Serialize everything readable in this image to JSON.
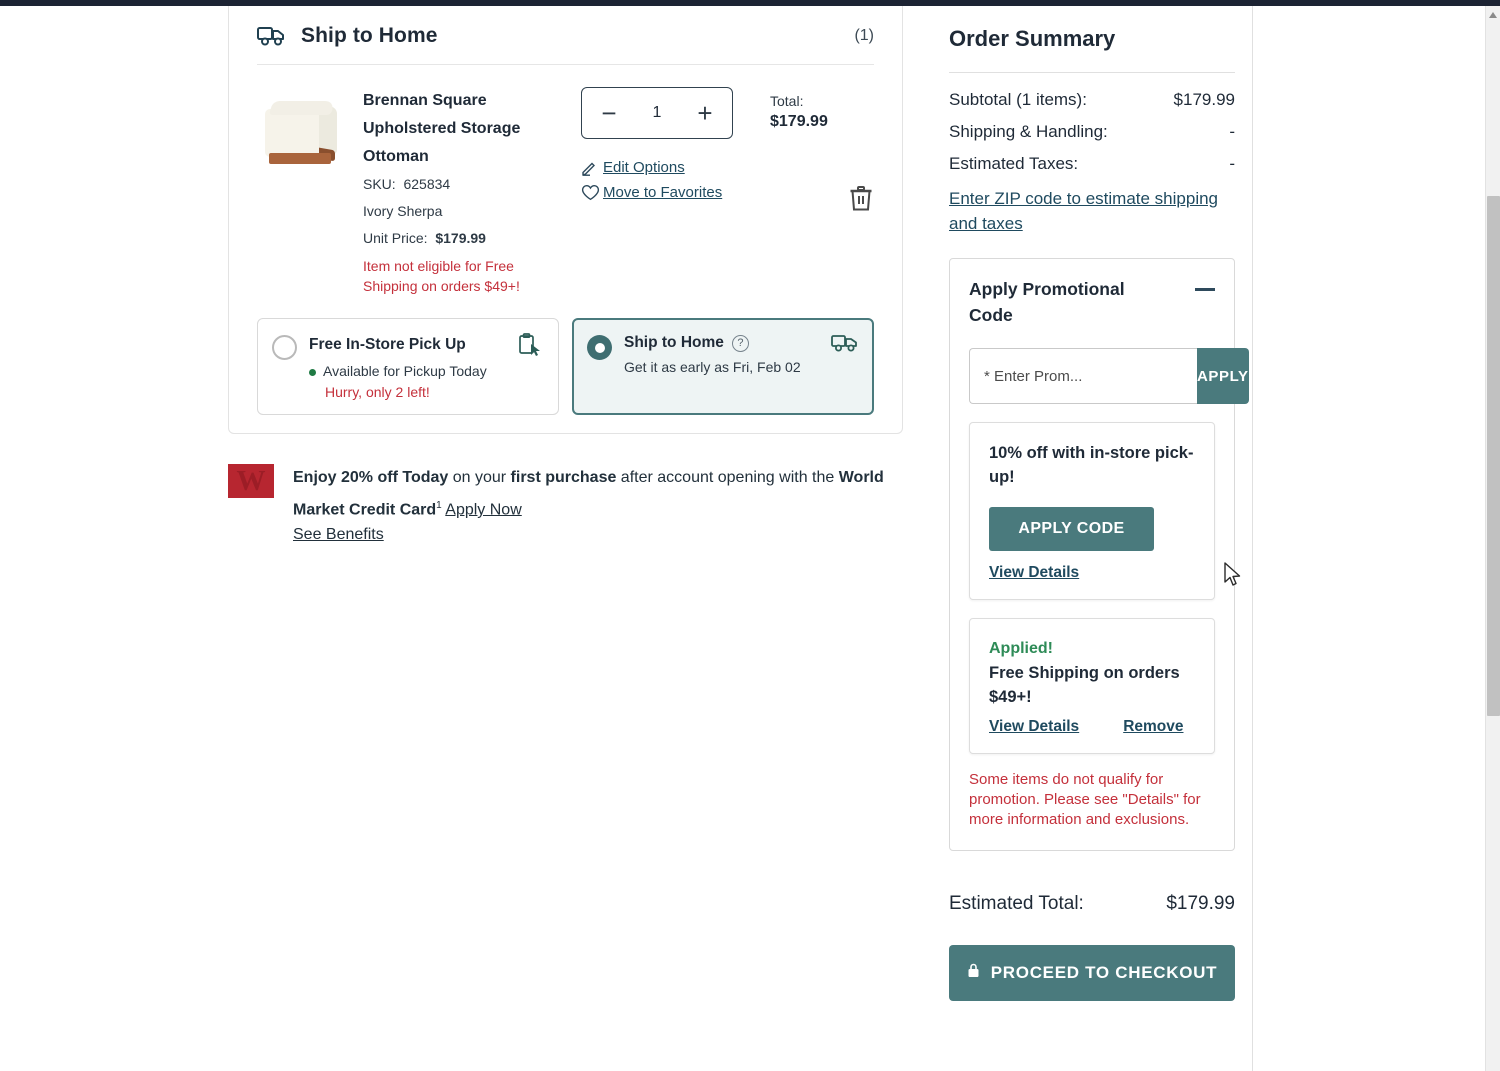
{
  "cart": {
    "section_title": "Ship to Home",
    "section_count": "(1)",
    "truck_icon": "truck-icon",
    "item": {
      "title": "Brennan Square Upholstered Storage Ottoman",
      "sku_label": "SKU:",
      "sku_value": "625834",
      "color": "Ivory Sherpa",
      "unit_price_label": "Unit Price:",
      "unit_price_value": "$179.99",
      "warning": "Item not eligible for Free Shipping on orders $49+!",
      "quantity": "1",
      "decrement": "−",
      "increment": "+",
      "edit_options": "Edit Options",
      "move_to_favorites": "Move to Favorites",
      "total_label": "Total:",
      "total_value": "$179.99",
      "remove_icon": "trash-icon",
      "edit_icon": "pencil-icon",
      "favorite_icon": "heart-icon"
    },
    "delivery_options": [
      {
        "title": "Free In-Store Pick Up",
        "icon": "store-pickup-icon",
        "availability": "Available for Pickup Today",
        "urgency": "Hurry, only 2 left!",
        "selected": false
      },
      {
        "title": "Ship to Home",
        "icon": "truck-icon",
        "help_icon": "question-mark-icon",
        "eta": "Get it as early as Fri, Feb 02",
        "selected": true
      }
    ]
  },
  "credit_banner": {
    "logo_letter": "W",
    "line1_a": "Enjoy 20% off Today",
    "line1_b": " on your ",
    "line1_c": "first purchase",
    "line1_d": " after account opening with the ",
    "line1_e": "World Market Credit Card",
    "footnote": "1",
    "apply_now": "Apply Now",
    "see_benefits": "See Benefits"
  },
  "summary": {
    "title": "Order Summary",
    "rows": [
      {
        "label": "Subtotal (1 items):",
        "value": "$179.99"
      },
      {
        "label": "Shipping & Handling:",
        "value": "-"
      },
      {
        "label": "Estimated Taxes:",
        "value": "-"
      }
    ],
    "zip_link": "Enter ZIP code to estimate shipping and taxes",
    "promo": {
      "title": "Apply Promotional Code",
      "collapse_icon": "minus-icon",
      "input_placeholder": "* Enter Prom...",
      "input_value": "",
      "apply_label": "APPLY",
      "offer": {
        "title": "10% off with in-store pick-up!",
        "apply_code_label": "APPLY CODE",
        "view_details": "View Details"
      },
      "applied": {
        "status": "Applied!",
        "title": "Free Shipping on orders $49+!",
        "view_details": "View Details",
        "remove": "Remove"
      },
      "note": "Some items do not qualify for promotion. Please see \"Details\" for more information and exclusions."
    },
    "estimated_total_label": "Estimated Total:",
    "estimated_total_value": "$179.99",
    "checkout_label": "PROCEED TO CHECKOUT",
    "checkout_icon": "lock-icon"
  },
  "colors": {
    "teal": "#4A7A7D",
    "dark_navy": "#1F2A37",
    "red": "#C4303B",
    "green": "#2E8B57",
    "link": "#1F4A5F",
    "brand_red": "#B72630"
  }
}
